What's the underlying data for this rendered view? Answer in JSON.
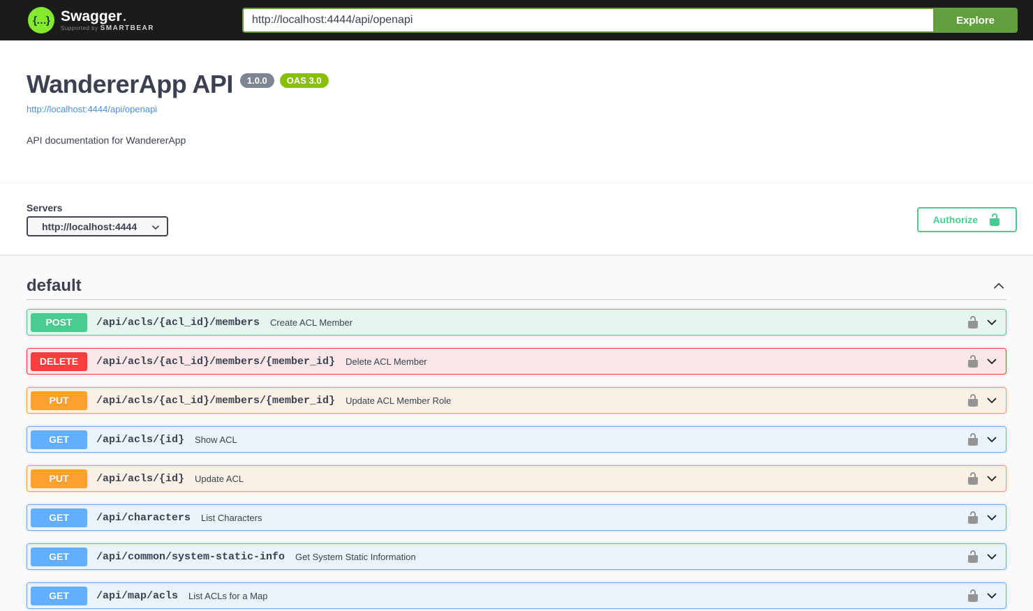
{
  "topbar": {
    "logo_glyph": "{…}",
    "logo_text": "Swagger",
    "tagline_prefix": "Supported by",
    "tagline_brand": "SMARTBEAR",
    "url_value": "http://localhost:4444/api/openapi",
    "explore_label": "Explore"
  },
  "info": {
    "title": "WandererApp API",
    "version_badge": "1.0.0",
    "oas_badge": "OAS 3.0",
    "spec_url": "http://localhost:4444/api/openapi",
    "description": "API documentation for WandererApp"
  },
  "scheme": {
    "servers_label": "Servers",
    "server_value": "http://localhost:4444",
    "authorize_label": "Authorize"
  },
  "operations": {
    "tag": "default",
    "rows": [
      {
        "method": "POST",
        "path": "/api/acls/{acl_id}/members",
        "summary": "Create ACL Member"
      },
      {
        "method": "DELETE",
        "path": "/api/acls/{acl_id}/members/{member_id}",
        "summary": "Delete ACL Member"
      },
      {
        "method": "PUT",
        "path": "/api/acls/{acl_id}/members/{member_id}",
        "summary": "Update ACL Member Role"
      },
      {
        "method": "GET",
        "path": "/api/acls/{id}",
        "summary": "Show ACL"
      },
      {
        "method": "PUT",
        "path": "/api/acls/{id}",
        "summary": "Update ACL"
      },
      {
        "method": "GET",
        "path": "/api/characters",
        "summary": "List Characters"
      },
      {
        "method": "GET",
        "path": "/api/common/system-static-info",
        "summary": "Get System Static Information"
      },
      {
        "method": "GET",
        "path": "/api/map/acls",
        "summary": "List ACLs for a Map"
      }
    ]
  },
  "colors": {
    "topbar_bg": "#1b1b1b",
    "logo_green": "#85ea2d",
    "explore_green": "#62a03f",
    "get_blue": "#61affe",
    "post_green": "#49cc90",
    "put_orange": "#fca130",
    "delete_red": "#f93e3e",
    "authorize_green": "#49cc90",
    "oas_badge_green": "#89bf04",
    "version_badge_gray": "#7d8492",
    "link_blue": "#4990e2",
    "text_dark": "#3b4151",
    "lock_gray": "#949494"
  }
}
